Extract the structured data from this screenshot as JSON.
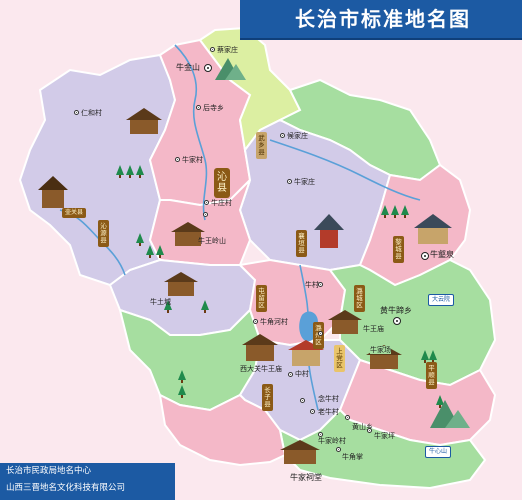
{
  "title": "长治市标准地名图",
  "footer": {
    "line1": "长治市民政局地名中心",
    "line2": "山西三晋地名文化科技有限公司"
  },
  "regions": {
    "qinxian": "沁县",
    "qinyuan": "沁源县",
    "wuxiang": "武乡县",
    "xiangyuan": "襄垣县",
    "licheng": "黎城县",
    "tunliu": "屯留区",
    "luzhou": "潞州区",
    "lucheng": "潞城区",
    "shangdang": "上党区",
    "changzi": "长子县",
    "huguan": "壶关县",
    "pingshun": "平顺县"
  },
  "places": {
    "p1": "蔡家庄",
    "p2": "牛金山",
    "p3": "后寺乡",
    "p4": "仁和村",
    "p5": "候家庄",
    "p6": "牛家村",
    "p7": "牛庄村",
    "p8": "牛王岭山",
    "p9": "牛村",
    "p10": "牛壑泉",
    "p11": "牛土城",
    "p12": "牛角河村",
    "p13": "牛王庙",
    "p14": "黄牛蹄乡",
    "p15": "大云院",
    "p16": "牛家场",
    "p17": "西大关牛王庙",
    "p18": "中村",
    "p19": "念牛村",
    "p20": "老牛村",
    "p21": "牛家祠堂",
    "p22": "黄山乡",
    "p23": "牛家坪",
    "p24": "牛家岭村",
    "p25": "牛角掌",
    "p26": "十八盘",
    "p27": "牛王洞",
    "p28": "牛心山",
    "p29": "牛家庄"
  },
  "icons": [
    "pagoda-icon",
    "temple-icon",
    "tree-icon",
    "mountain-icon",
    "village-dot-icon",
    "capital-dot-icon"
  ],
  "colors": {
    "title_band": "#1c5aa3",
    "river": "#5aa0d8",
    "region_green": "#a8e0a0",
    "region_pink": "#f4b6c6",
    "region_lilac": "#cfc6e8",
    "region_lime": "#dcf0a0"
  }
}
